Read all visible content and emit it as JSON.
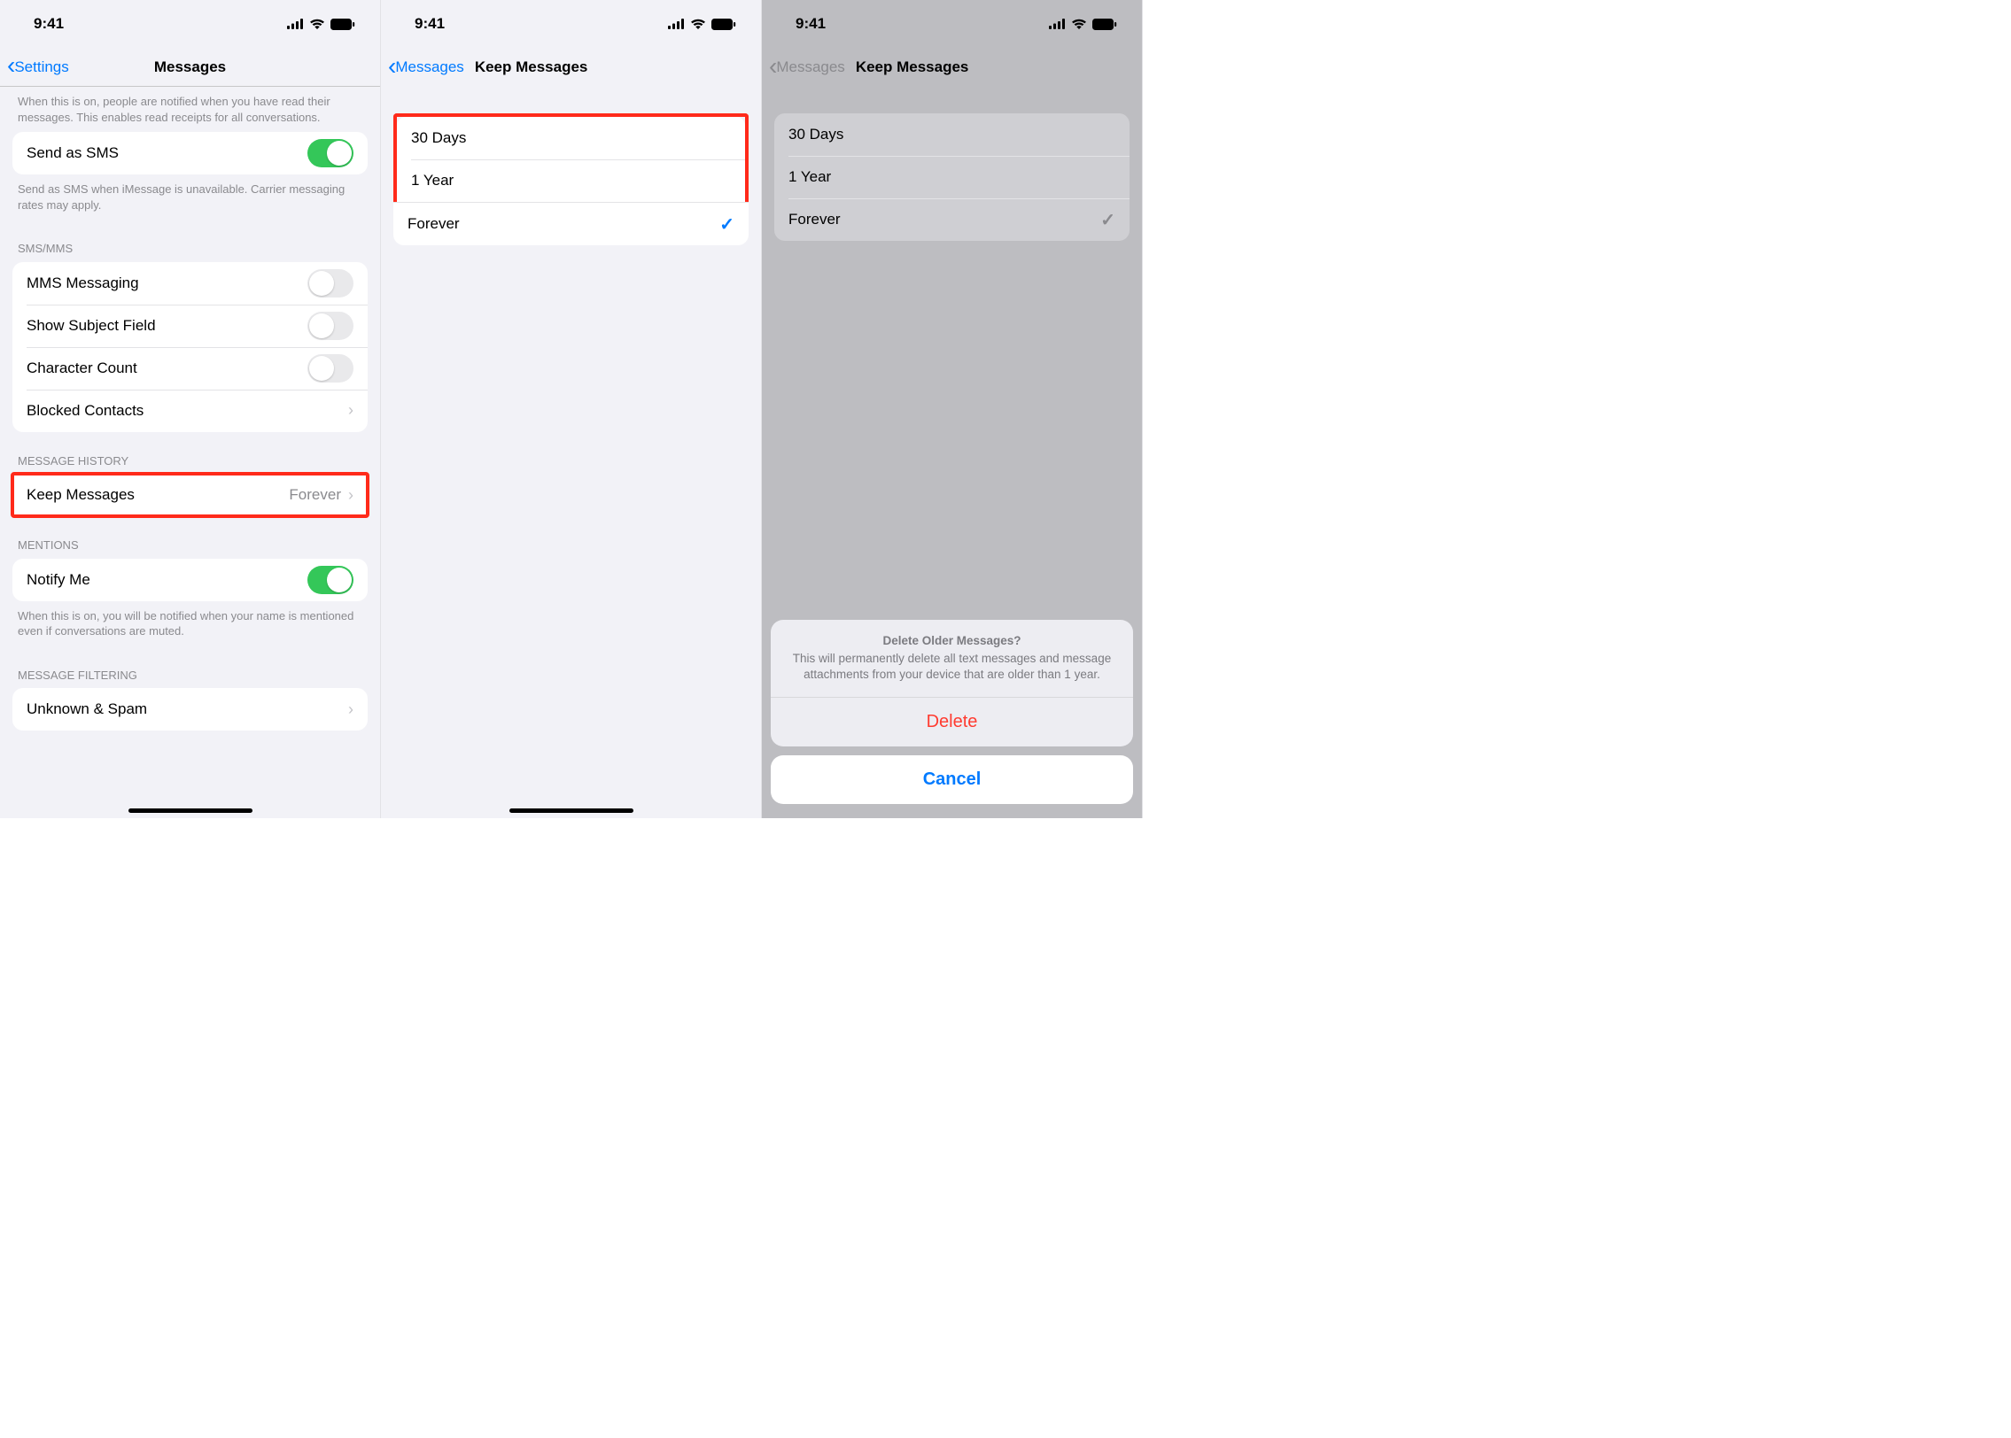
{
  "status": {
    "time": "9:41"
  },
  "screen1": {
    "back": "Settings",
    "title": "Messages",
    "readReceiptsFooter": "When this is on, people are notified when you have read their messages. This enables read receipts for all conversations.",
    "sendSMS": {
      "label": "Send as SMS",
      "on": true
    },
    "sendSMSFooter": "Send as SMS when iMessage is unavailable. Carrier messaging rates may apply.",
    "smsHeader": "SMS/MMS",
    "rows": {
      "mms": "MMS Messaging",
      "subject": "Show Subject Field",
      "charCount": "Character Count",
      "blocked": "Blocked Contacts"
    },
    "historyHeader": "MESSAGE HISTORY",
    "keep": {
      "label": "Keep Messages",
      "value": "Forever"
    },
    "mentionsHeader": "MENTIONS",
    "notify": {
      "label": "Notify Me",
      "on": true
    },
    "notifyFooter": "When this is on, you will be notified when your name is mentioned even if conversations are muted.",
    "filterHeader": "MESSAGE FILTERING",
    "unknown": "Unknown & Spam"
  },
  "screen2": {
    "back": "Messages",
    "title": "Keep Messages",
    "options": {
      "d30": "30 Days",
      "y1": "1 Year",
      "forever": "Forever"
    }
  },
  "screen3": {
    "back": "Messages",
    "title": "Keep Messages",
    "options": {
      "d30": "30 Days",
      "y1": "1 Year",
      "forever": "Forever"
    },
    "sheet": {
      "title": "Delete Older Messages?",
      "message": "This will permanently delete all text messages and message attachments from your device that are older than 1 year.",
      "delete": "Delete",
      "cancel": "Cancel"
    }
  }
}
